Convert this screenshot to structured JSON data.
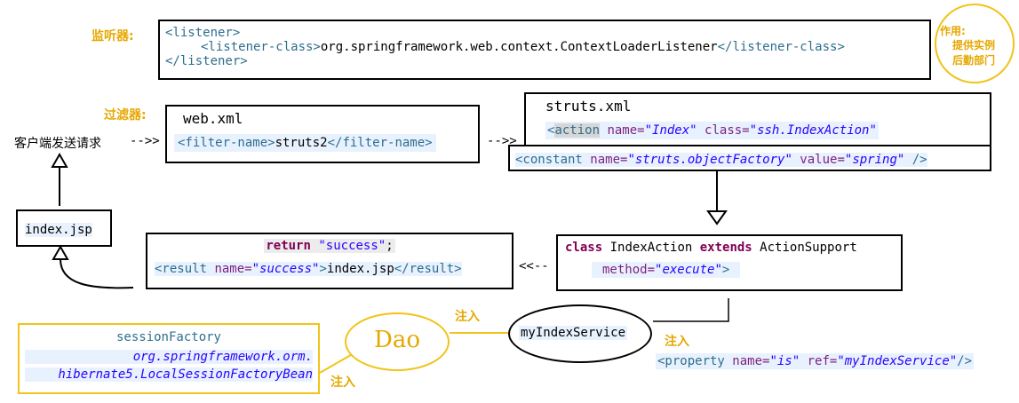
{
  "labels": {
    "listener": "监听器:",
    "filter": "过滤器:",
    "client": "客户端发送请求",
    "inject1": "注入",
    "inject2": "注入",
    "inject3": "注入"
  },
  "note": {
    "title": "作用:",
    "line1": "提供实例",
    "line2": "后勤部门"
  },
  "listener_box": {
    "open": "<listener>",
    "class_open": "<listener-class>",
    "class_value": "org.springframework.web.context.ContextLoaderListener",
    "class_close": "</listener-class>",
    "close": "</listener>"
  },
  "webxml_box": {
    "title": "web.xml",
    "open": "<filter-name>",
    "value": "struts2",
    "close": "</filter-name>"
  },
  "struts_box": {
    "title": "struts.xml",
    "action_open": "<",
    "action_tag": "action",
    "name_attr": " name=",
    "name_val": "\"Index\"",
    "class_attr": " class=",
    "class_val": "\"ssh.IndexAction\"",
    "const_open": "<constant",
    "const_name_attr": " name=",
    "const_name_val": "\"struts.objectFactory\"",
    "const_value_attr": " value=",
    "const_value_val": "\"spring\"",
    "const_close": " />"
  },
  "index_box": {
    "label": "index.jsp"
  },
  "result_box": {
    "return_kw": "return",
    "return_str": " \"success\"",
    "return_end": ";",
    "result_open": "<result",
    "name_attr": " name=",
    "name_val": "\"success\"",
    "gt": ">",
    "page": "index.jsp",
    "result_close": "</result>"
  },
  "action_box": {
    "class_kw": "class",
    "class_name": " IndexAction ",
    "extends_kw": "extends",
    "parent": " ActionSupport",
    "method_attr": "method=",
    "method_val": "\"execute\"",
    "gt": ">"
  },
  "service": {
    "label": "myIndexService"
  },
  "dao": {
    "label": "Dao"
  },
  "property": {
    "open": "<property",
    "name_attr": " name=",
    "name_val": "\"is\"",
    "ref_attr": " ref=",
    "ref_val": "\"myIndexService\"",
    "close": "/>"
  },
  "session_box": {
    "title": "sessionFactory",
    "line1": "org.springframework.orm.",
    "line2": "hibernate5.LocalSessionFactoryBean"
  },
  "arrows": {
    "client_to_web": "-->>",
    "web_to_struts": "-->>",
    "action_to_result": "<<--"
  },
  "colors": {
    "yellow": "#f0c419",
    "label_yellow": "#e6a700",
    "tag": "#2e6e8e",
    "attr": "#7f1f7f",
    "value": "#2a00ff",
    "keyword": "#7f0055"
  }
}
